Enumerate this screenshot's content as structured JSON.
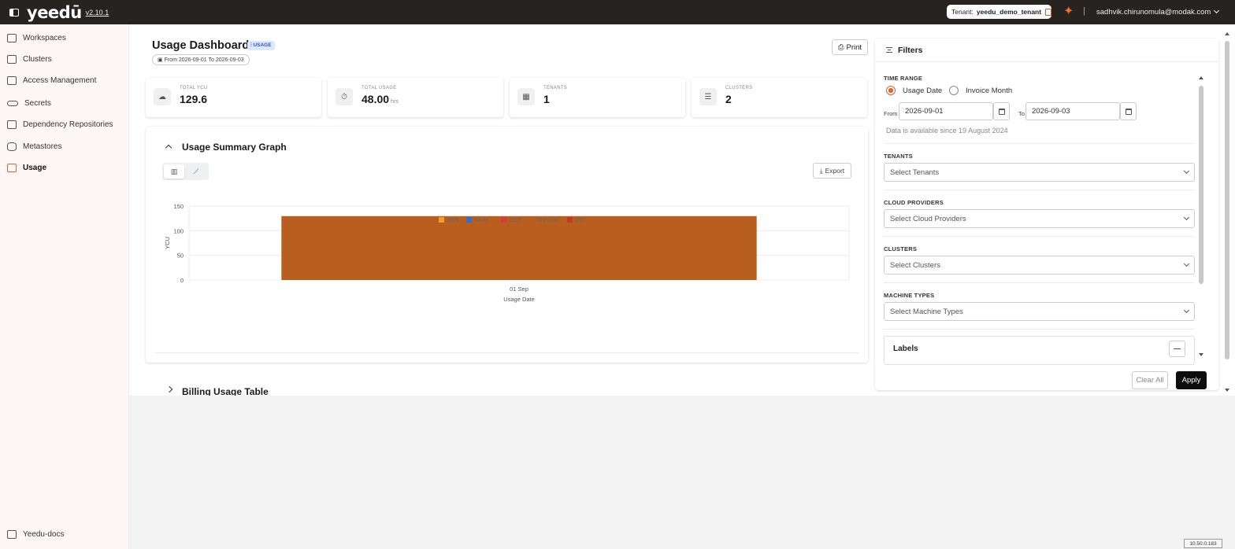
{
  "topbar": {
    "logo": "yeedū",
    "version": "v2.10.1",
    "tenant_label": "Tenant:",
    "tenant_name": "yeedu_demo_tenant",
    "separator": "|",
    "user_email": "sadhvik.chirunomula@modak.com"
  },
  "sidebar": {
    "items": [
      {
        "label": "Workspaces",
        "icon": "monitor-icon"
      },
      {
        "label": "Clusters",
        "icon": "cluster-icon"
      },
      {
        "label": "Access Management",
        "icon": "id-card-icon"
      },
      {
        "label": "Secrets",
        "icon": "key-icon"
      },
      {
        "label": "Dependency Repositories",
        "icon": "repository-icon"
      },
      {
        "label": "Metastores",
        "icon": "database-icon"
      },
      {
        "label": "Usage",
        "icon": "usage-icon",
        "active": true
      }
    ],
    "footer_label": "Yeedu-docs"
  },
  "header": {
    "title": "Usage Dashboard",
    "badge": "USAGE",
    "date_range": "From 2026-09-01 To 2026-09-03",
    "print_label": "Print"
  },
  "stats": [
    {
      "label": "TOTAL YCU",
      "value": "129.6",
      "unit": "",
      "icon": "cloud-icon"
    },
    {
      "label": "TOTAL USAGE",
      "value": "48.00",
      "unit": "hrs",
      "icon": "stopwatch-icon"
    },
    {
      "label": "TENANTS",
      "value": "1",
      "unit": "",
      "icon": "building-icon"
    },
    {
      "label": "CLUSTERS",
      "value": "2",
      "unit": "",
      "icon": "list-icon"
    }
  ],
  "graph_panel": {
    "title": "Usage Summary Graph",
    "export_label": "Export"
  },
  "chart_data": {
    "type": "bar",
    "categories": [
      "01 Sep"
    ],
    "series": [
      {
        "name": "AWS",
        "color": "#f39c2b",
        "values": [
          0
        ]
      },
      {
        "name": "Azure",
        "color": "#2f6fd6",
        "values": [
          0
        ]
      },
      {
        "name": "GCP",
        "color": "#d93a3a",
        "values": [
          0
        ]
      },
      {
        "name": "OnPrem",
        "color": "#b85f1f",
        "values": [
          129.6
        ]
      },
      {
        "name": "OCI",
        "color": "#c0392b",
        "values": [
          0
        ]
      }
    ],
    "xlabel": "Usage Date",
    "ylabel": "YCU",
    "yticks": [
      0,
      50,
      100,
      150
    ],
    "ylim": [
      0,
      150
    ],
    "grid": true,
    "legend": "top-center"
  },
  "billing_panel": {
    "title": "Billing Usage Table"
  },
  "filters": {
    "title": "Filters",
    "time_range_label": "TIME RANGE",
    "radio_usage_date": "Usage Date",
    "radio_invoice_month": "Invoice Month",
    "from_label": "From",
    "from_value": "2026-09-01",
    "to_label": "To",
    "to_value": "2026-09-03",
    "hint": "Data is available since 19 August 2024",
    "tenants_label": "TENANTS",
    "tenants_placeholder": "Select Tenants",
    "cloud_label": "CLOUD PROVIDERS",
    "cloud_placeholder": "Select Cloud Providers",
    "clusters_label": "CLUSTERS",
    "clusters_placeholder": "Select Clusters",
    "machine_label": "MACHINE TYPES",
    "machine_placeholder": "Select Machine Types",
    "labels_title": "Labels",
    "clear_label": "Clear All",
    "apply_label": "Apply"
  },
  "footer": {
    "ip": "10.50.0.183"
  }
}
